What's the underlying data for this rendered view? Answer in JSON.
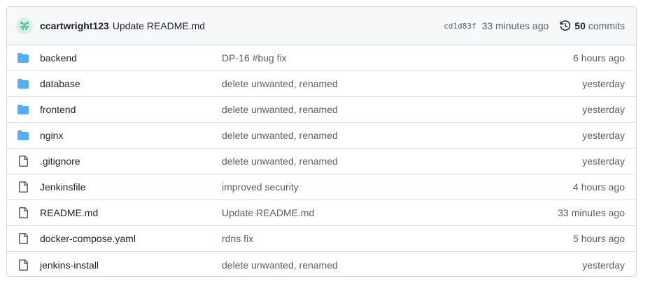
{
  "header": {
    "author": "ccartwright123",
    "message": "Update README.md",
    "sha": "cd1d83f",
    "age": "33 minutes ago",
    "commit_count": "50",
    "commits_label": "commits"
  },
  "colors": {
    "folder": "#54aeff",
    "file": "#57606a",
    "avatar": "#6cc7a8"
  },
  "files": [
    {
      "type": "folder",
      "icon": "folder-icon",
      "name": "backend",
      "message": "DP-16 #bug fix",
      "time": "6 hours ago"
    },
    {
      "type": "folder",
      "icon": "folder-icon",
      "name": "database",
      "message": "delete unwanted, renamed",
      "time": "yesterday"
    },
    {
      "type": "folder",
      "icon": "folder-icon",
      "name": "frontend",
      "message": "delete unwanted, renamed",
      "time": "yesterday"
    },
    {
      "type": "folder",
      "icon": "folder-icon",
      "name": "nginx",
      "message": "delete unwanted, renamed",
      "time": "yesterday"
    },
    {
      "type": "file",
      "icon": "file-icon",
      "name": ".gitignore",
      "message": "delete unwanted, renamed",
      "time": "yesterday"
    },
    {
      "type": "file",
      "icon": "file-icon",
      "name": "Jenkinsfile",
      "message": "improved security",
      "time": "4 hours ago"
    },
    {
      "type": "file",
      "icon": "file-icon",
      "name": "README.md",
      "message": "Update README.md",
      "time": "33 minutes ago"
    },
    {
      "type": "file",
      "icon": "file-icon",
      "name": "docker-compose.yaml",
      "message": "rdns fix",
      "time": "5 hours ago"
    },
    {
      "type": "file",
      "icon": "file-icon",
      "name": "jenkins-install",
      "message": "delete unwanted, renamed",
      "time": "yesterday"
    }
  ]
}
